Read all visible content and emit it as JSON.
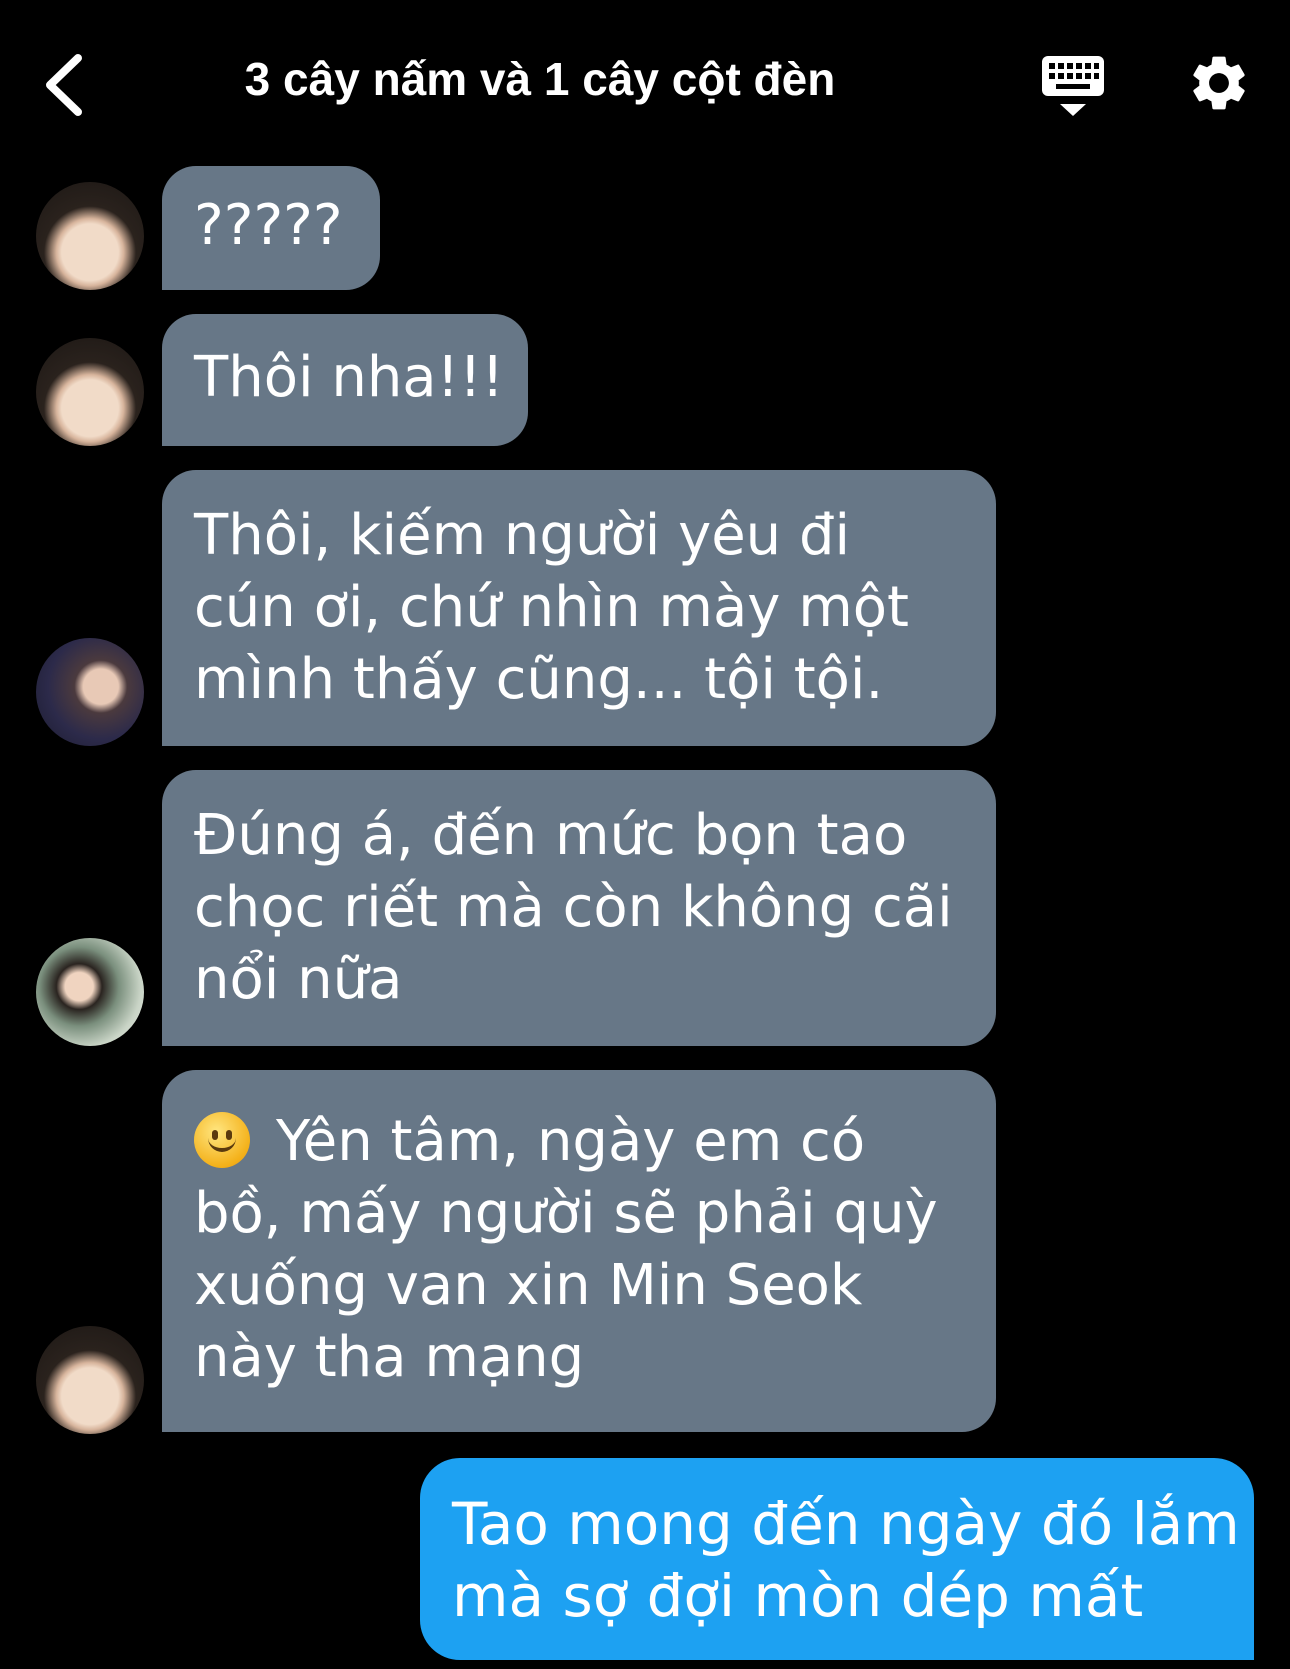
{
  "header": {
    "title": "3 cây nấm và 1 cây cột đèn",
    "back_icon": "chevron-left-icon",
    "keyboard_icon": "keyboard-icon",
    "settings_icon": "gear-icon"
  },
  "colors": {
    "background": "#000000",
    "incoming_bubble": "#677787",
    "outgoing_bubble": "#1da1f2",
    "text": "#ffffff"
  },
  "messages": [
    {
      "from": "member-1",
      "lines": [
        "?????"
      ]
    },
    {
      "from": "member-1",
      "lines": [
        "Thôi nha!!!"
      ]
    },
    {
      "from": "member-2",
      "lines": [
        "Thôi, kiếm người yêu đi",
        "cún ơi, chứ nhìn mày một",
        "mình thấy cũng... tội tội."
      ]
    },
    {
      "from": "member-3",
      "lines": [
        "Đúng á, đến mức bọn tao",
        "chọc riết mà còn không cãi",
        "nổi nữa"
      ]
    },
    {
      "from": "member-1",
      "emoji": "slightly-smiling-face-icon",
      "lines": [
        "Yên tâm, ngày em có",
        "bồ, mấy người  sẽ phải quỳ",
        "xuống van xin Min Seok",
        "này  tha mạng"
      ]
    },
    {
      "from": "me",
      "lines": [
        "Tao mong đến ngày đó lắm",
        "mà sợ đợi mòn dép mất"
      ]
    }
  ]
}
